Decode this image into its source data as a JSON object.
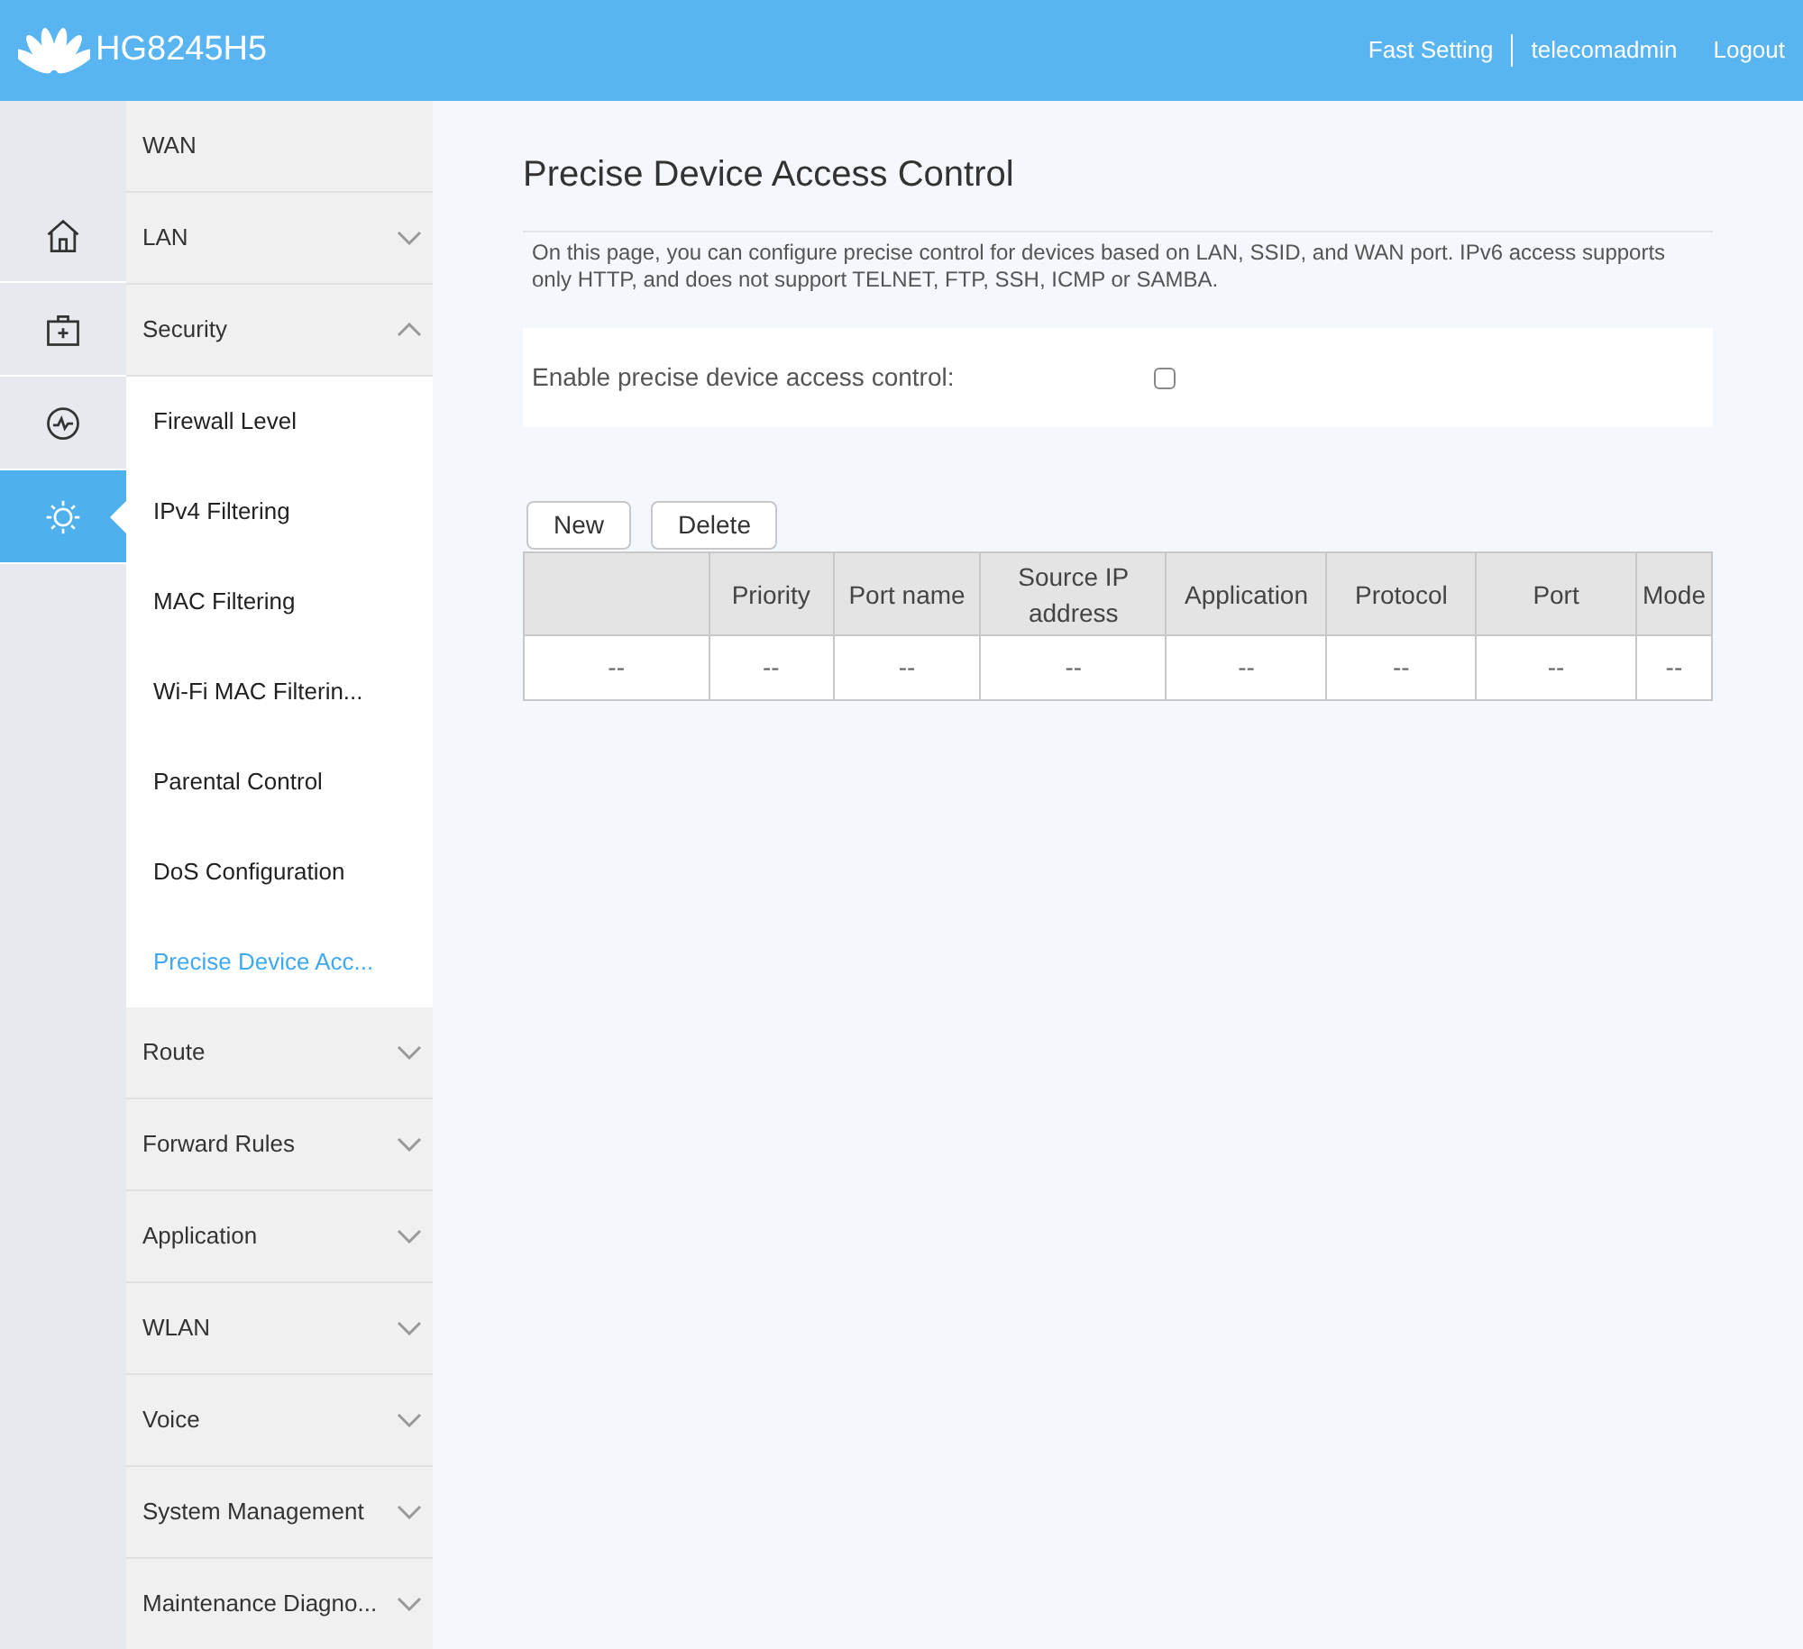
{
  "header": {
    "logo_text": "HG8245H5",
    "links": [
      "Fast Setting",
      "telecomadmin",
      "Logout"
    ]
  },
  "rail": [
    {
      "selected": false
    },
    {
      "selected": false
    },
    {
      "selected": false
    },
    {
      "selected": true
    }
  ],
  "menu": [
    {
      "label": "WAN"
    },
    {
      "label": "LAN",
      "expanded": false
    },
    {
      "label": "Security",
      "expanded": true,
      "children": [
        {
          "label": "Firewall Level",
          "selected": false
        },
        {
          "label": "IPv4 Filtering",
          "selected": false
        },
        {
          "label": "MAC Filtering",
          "selected": false
        },
        {
          "label": "Wi-Fi MAC Filterin...",
          "selected": false
        },
        {
          "label": "Parental Control",
          "selected": false
        },
        {
          "label": "DoS Configuration",
          "selected": false
        },
        {
          "label": "Precise Device Acc...",
          "selected": true
        }
      ]
    },
    {
      "label": "Route",
      "expanded": false
    },
    {
      "label": "Forward Rules",
      "expanded": false
    },
    {
      "label": "Application",
      "expanded": false
    },
    {
      "label": "WLAN",
      "expanded": false
    },
    {
      "label": "Voice",
      "expanded": false
    },
    {
      "label": "System Management",
      "expanded": false
    },
    {
      "label": "Maintenance Diagno...",
      "expanded": false
    }
  ],
  "page": {
    "title": "Precise Device Access Control",
    "description": "On this page, you can configure precise control for devices based on LAN, SSID, and WAN port. IPv6 access supports only HTTP, and does not support TELNET, FTP, SSH, ICMP or SAMBA.",
    "enable": {
      "label": "Enable precise device access control:",
      "checked": false
    },
    "buttons": [
      "New",
      "Delete"
    ],
    "table": {
      "columns": [
        "",
        "Priority",
        "Port name",
        "Source IP address",
        "Application",
        "Protocol",
        "Port",
        "Mode"
      ],
      "rows": [
        [
          "--",
          "--",
          "--",
          "--",
          "--",
          "--",
          "--",
          "--"
        ]
      ]
    }
  }
}
